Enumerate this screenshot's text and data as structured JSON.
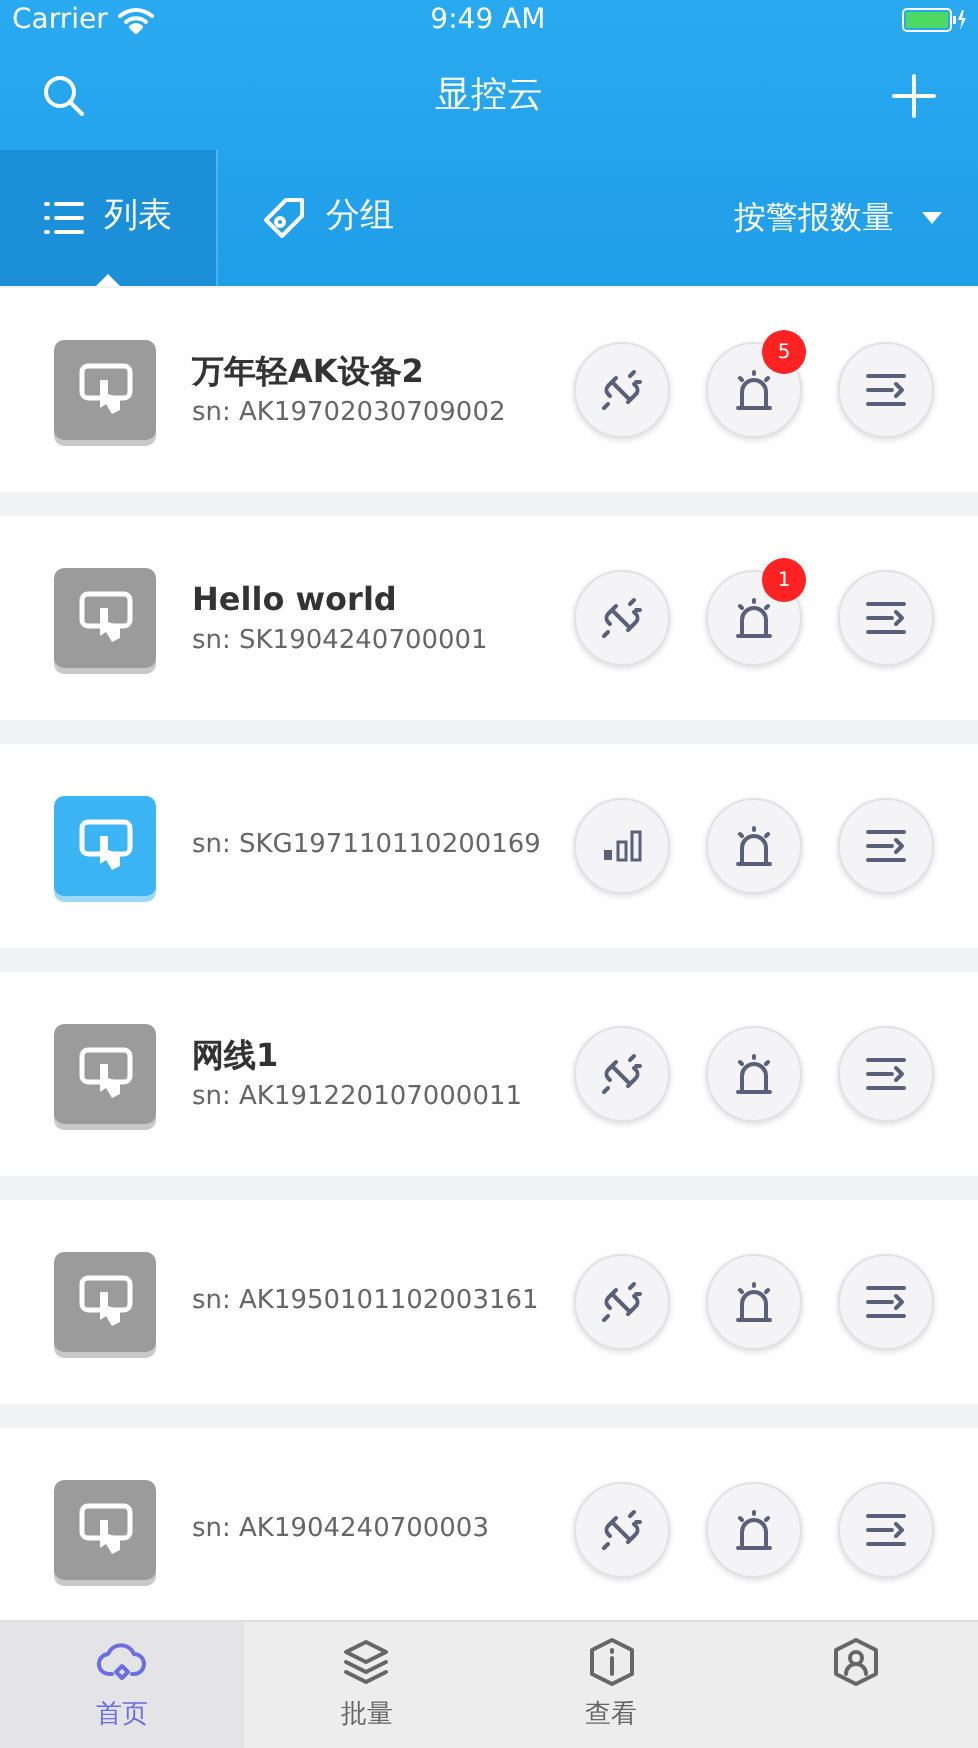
{
  "status_bar": {
    "carrier": "Carrier",
    "time": "9:49 AM"
  },
  "header": {
    "title": "显控云"
  },
  "tabs": [
    {
      "label": "列表",
      "selected": true
    },
    {
      "label": "分组",
      "selected": false
    }
  ],
  "sort": {
    "label": "按警报数量"
  },
  "devices": [
    {
      "name": "万年轻AK设备2",
      "sn": "sn: AK19702030709002",
      "online": false,
      "kind": "unlinked",
      "alarms": "5"
    },
    {
      "name": "Hello world",
      "sn": "sn: SK1904240700001",
      "online": false,
      "kind": "unlinked",
      "alarms": "1"
    },
    {
      "sn": "sn: SKG197110110200169",
      "online": true,
      "kind": "signal"
    },
    {
      "name": "网线1",
      "sn": "sn: AK191220107000011",
      "online": false,
      "kind": "unlinked"
    },
    {
      "sn": "sn: AK1950101102003161",
      "online": false,
      "kind": "unlinked"
    },
    {
      "sn": "sn: AK1904240700003",
      "online": false,
      "kind": "unlinked"
    }
  ],
  "bottom_tabs": [
    {
      "label": "首页",
      "selected": true
    },
    {
      "label": "批量",
      "selected": false
    },
    {
      "label": "查看",
      "selected": false
    },
    {
      "selected": false
    }
  ]
}
